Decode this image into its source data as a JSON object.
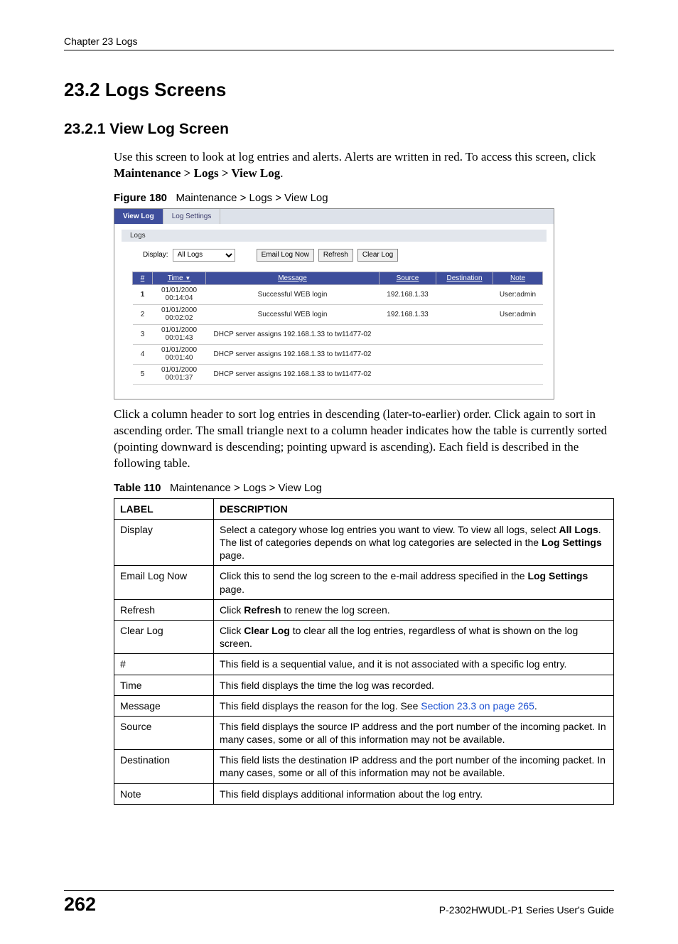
{
  "header": {
    "chapter": "Chapter 23 Logs"
  },
  "h1": "23.2  Logs Screens",
  "h2": "23.2.1  View Log Screen",
  "intro": {
    "p1a": "Use this screen to look at log entries and alerts. Alerts are written in red. To access this screen, click ",
    "p1b": "Maintenance > Logs > View Log",
    "p1c": "."
  },
  "figure": {
    "label": "Figure 180",
    "caption": "Maintenance > Logs > View Log"
  },
  "viewlog": {
    "tabs": {
      "active": "View Log",
      "other": "Log Settings"
    },
    "section": "Logs",
    "display_label": "Display:",
    "display_value": "All Logs",
    "btn_email": "Email Log Now",
    "btn_refresh": "Refresh",
    "btn_clear": "Clear Log",
    "cols": {
      "num": "#",
      "time": "Time",
      "msg": "Message",
      "src": "Source",
      "dst": "Destination",
      "note": "Note"
    },
    "rows": [
      {
        "n": "1",
        "t1": "01/01/2000",
        "t2": "00:14:04",
        "msg": "Successful WEB login",
        "src": "192.168.1.33",
        "dst": "",
        "note": "User:admin"
      },
      {
        "n": "2",
        "t1": "01/01/2000",
        "t2": "00:02:02",
        "msg": "Successful WEB login",
        "src": "192.168.1.33",
        "dst": "",
        "note": "User:admin"
      },
      {
        "n": "3",
        "t1": "01/01/2000",
        "t2": "00:01:43",
        "msg": "DHCP server assigns 192.168.1.33 to tw11477-02",
        "src": "",
        "dst": "",
        "note": ""
      },
      {
        "n": "4",
        "t1": "01/01/2000",
        "t2": "00:01:40",
        "msg": "DHCP server assigns 192.168.1.33 to tw11477-02",
        "src": "",
        "dst": "",
        "note": ""
      },
      {
        "n": "5",
        "t1": "01/01/2000",
        "t2": "00:01:37",
        "msg": "DHCP server assigns 192.168.1.33 to tw11477-02",
        "src": "",
        "dst": "",
        "note": ""
      }
    ]
  },
  "after_fig": "Click a column header to sort log entries in descending (later-to-earlier) order. Click again to sort in ascending order. The small triangle next to a column header indicates how the table is currently sorted (pointing downward is descending; pointing upward is ascending). Each field is described in the following table.",
  "table": {
    "label": "Table 110",
    "caption": "Maintenance > Logs > View Log",
    "head": {
      "label": "LABEL",
      "desc": "DESCRIPTION"
    },
    "rows": {
      "r0": {
        "label": "Display",
        "d1": "Select a category whose log entries you want to view. To view all logs, select ",
        "b1": "All Logs",
        "d2": ". The list of categories depends on what log categories are selected in the ",
        "b2": "Log Settings",
        "d3": " page."
      },
      "r1": {
        "label": "Email Log Now",
        "d1": "Click this to send the log screen to the e-mail address specified in the ",
        "b1": "Log Settings",
        "d2": " page."
      },
      "r2": {
        "label": "Refresh",
        "d1": "Click ",
        "b1": "Refresh",
        "d2": " to renew the log screen."
      },
      "r3": {
        "label": "Clear Log",
        "d1": "Click ",
        "b1": "Clear Log",
        "d2": " to clear all the log entries, regardless of what is shown on the log screen."
      },
      "r4": {
        "label": "#",
        "d": "This field is a sequential value, and it is not associated with a specific log entry."
      },
      "r5": {
        "label": "Time",
        "d": "This field displays the time the log was recorded."
      },
      "r6": {
        "label": "Message",
        "d1": "This field displays the reason for the log. See ",
        "link": "Section 23.3 on page 265",
        "d2": "."
      },
      "r7": {
        "label": "Source",
        "d": "This field displays the source IP address and the port number of the incoming packet. In many cases, some or all of this information may not be available."
      },
      "r8": {
        "label": "Destination",
        "d": "This field lists the destination IP address and the port number of the incoming packet. In many cases, some or all of this information may not be available."
      },
      "r9": {
        "label": "Note",
        "d": "This field displays additional information about the log entry."
      }
    }
  },
  "footer": {
    "page": "262",
    "guide": "P-2302HWUDL-P1 Series User's Guide"
  }
}
